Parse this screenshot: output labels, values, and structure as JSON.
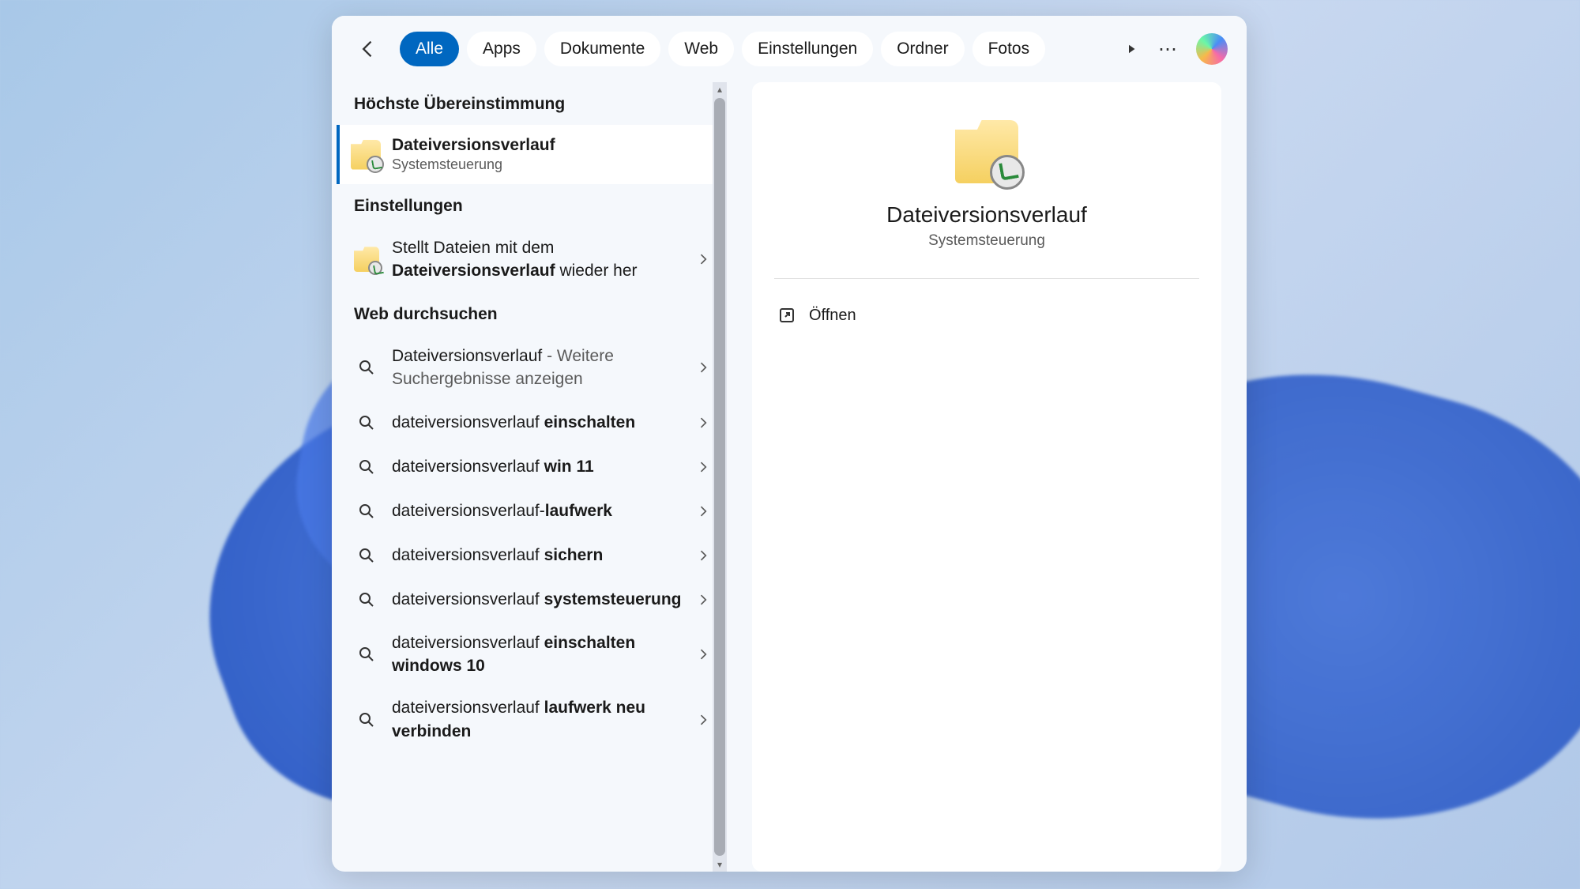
{
  "filters": {
    "all": "Alle",
    "apps": "Apps",
    "documents": "Dokumente",
    "web": "Web",
    "settings": "Einstellungen",
    "folders": "Ordner",
    "photos": "Fotos"
  },
  "sections": {
    "best_match": "Höchste Übereinstimmung",
    "settings": "Einstellungen",
    "search_web": "Web durchsuchen"
  },
  "best_match": {
    "title": "Dateiversionsverlauf",
    "subtitle": "Systemsteuerung"
  },
  "settings_results": [
    {
      "prefix": "Stellt Dateien mit dem ",
      "bold": "Dateiversionsverlauf",
      "suffix": " wieder her"
    }
  ],
  "web_results": [
    {
      "pre": "Dateiversionsverlauf",
      "grey": " - Weitere Suchergebnisse anzeigen",
      "bold": ""
    },
    {
      "pre": "dateiversionsverlauf ",
      "bold": "einschalten",
      "grey": ""
    },
    {
      "pre": "dateiversionsverlauf ",
      "bold": "win 11",
      "grey": ""
    },
    {
      "pre": "dateiversionsverlauf-",
      "bold": "laufwerk",
      "grey": ""
    },
    {
      "pre": "dateiversionsverlauf ",
      "bold": "sichern",
      "grey": ""
    },
    {
      "pre": "dateiversionsverlauf ",
      "bold": "systemsteuerung",
      "grey": ""
    },
    {
      "pre": "dateiversionsverlauf ",
      "bold": "einschalten windows 10",
      "grey": ""
    },
    {
      "pre": "dateiversionsverlauf ",
      "bold": "laufwerk neu verbinden",
      "grey": ""
    }
  ],
  "preview": {
    "title": "Dateiversionsverlauf",
    "subtitle": "Systemsteuerung",
    "open_label": "Öffnen"
  }
}
